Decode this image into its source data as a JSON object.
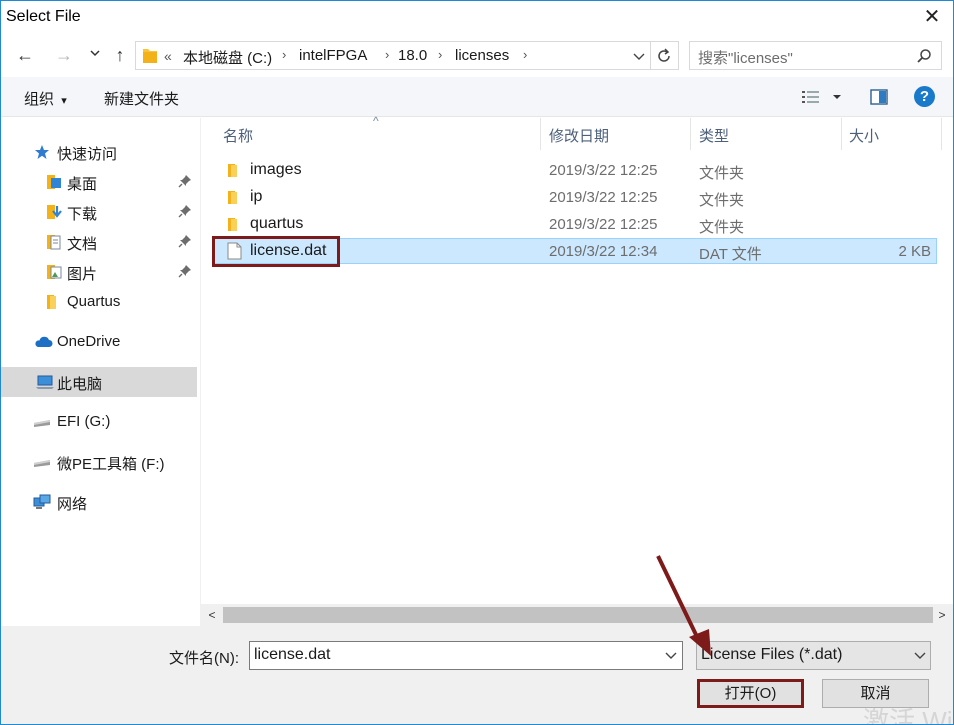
{
  "window": {
    "title": "Select File",
    "close_glyph": "✕"
  },
  "nav": {
    "back_glyph": "←",
    "forward_glyph": "→",
    "recent_glyph": "⌄",
    "up_glyph": "↑",
    "breadcrumb_overflow": "«",
    "breadcrumbs": [
      "本地磁盘 (C:)",
      "intelFPGA",
      "18.0",
      "licenses"
    ],
    "crumb_sep": "›",
    "search_placeholder": "搜索\"licenses\""
  },
  "toolbar": {
    "organize_label": "组织",
    "organize_caret": "▾",
    "new_folder_label": "新建文件夹",
    "help_glyph": "?"
  },
  "sidebar": {
    "items": [
      {
        "label": "快速访问",
        "icon": "star-icon"
      },
      {
        "label": "桌面",
        "icon": "desktop-icon",
        "pinned": true
      },
      {
        "label": "下载",
        "icon": "download-icon",
        "pinned": true
      },
      {
        "label": "文档",
        "icon": "document-icon",
        "pinned": true
      },
      {
        "label": "图片",
        "icon": "picture-icon",
        "pinned": true
      },
      {
        "label": "Quartus",
        "icon": "folder-icon"
      },
      {
        "label": "OneDrive",
        "icon": "cloud-icon"
      },
      {
        "label": "此电脑",
        "icon": "computer-icon",
        "selected": true
      },
      {
        "label": "EFI (G:)",
        "icon": "drive-icon"
      },
      {
        "label": "微PE工具箱 (F:)",
        "icon": "drive-icon"
      },
      {
        "label": "网络",
        "icon": "network-icon"
      }
    ]
  },
  "file_list": {
    "columns": [
      "名称",
      "修改日期",
      "类型",
      "大小"
    ],
    "sort_glyph": "^",
    "rows": [
      {
        "name": "images",
        "date": "2019/3/22 12:25",
        "type": "文件夹",
        "size": "",
        "icon": "folder-icon"
      },
      {
        "name": "ip",
        "date": "2019/3/22 12:25",
        "type": "文件夹",
        "size": "",
        "icon": "folder-icon"
      },
      {
        "name": "quartus",
        "date": "2019/3/22 12:25",
        "type": "文件夹",
        "size": "",
        "icon": "folder-icon"
      },
      {
        "name": "license.dat",
        "date": "2019/3/22 12:34",
        "type": "DAT 文件",
        "size": "2 KB",
        "icon": "file-icon",
        "selected": true
      }
    ]
  },
  "scroll": {
    "left_glyph": "<",
    "right_glyph": ">"
  },
  "footer": {
    "filename_label": "文件名(N):",
    "filename_value": "license.dat",
    "filter_value": "License Files (*.dat)",
    "open_label": "打开(O)",
    "cancel_label": "取消"
  },
  "watermark": "激活 Wi",
  "colors": {
    "accent_red": "#7d1a1a",
    "selection": "#cce8ff",
    "folder": "#f8c537",
    "help": "#1979ca"
  }
}
